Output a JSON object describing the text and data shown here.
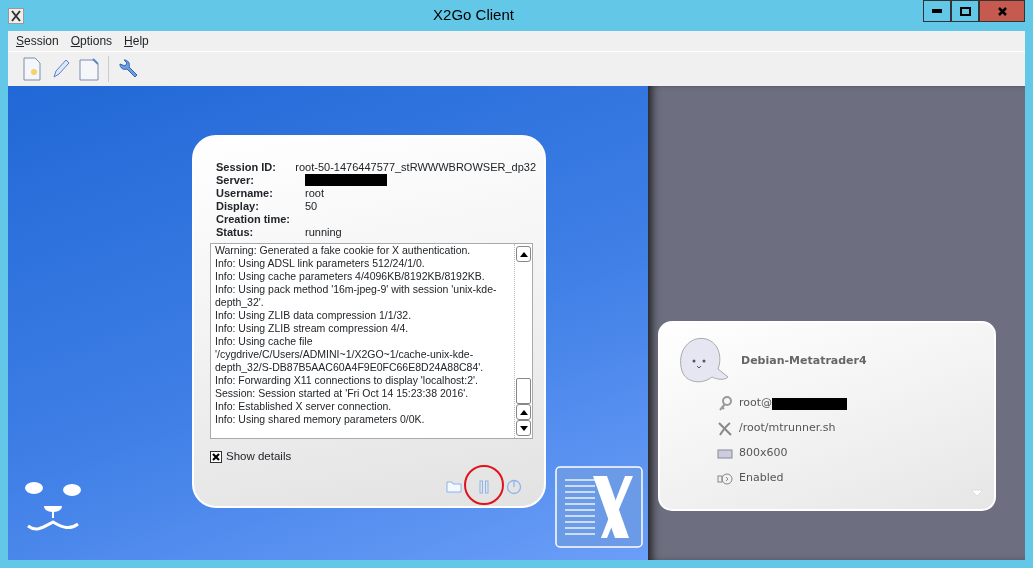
{
  "window": {
    "title": "X2Go Client"
  },
  "menu": [
    {
      "label": "Session"
    },
    {
      "label": "Options"
    },
    {
      "label": "Help"
    }
  ],
  "session_info": {
    "fields": [
      {
        "label": "Session ID:",
        "value": "root-50-1476447577_stRWWWBROWSER_dp32",
        "redacted": false
      },
      {
        "label": "Server:",
        "redacted": true
      },
      {
        "label": "Username:",
        "value": "root",
        "redacted": false
      },
      {
        "label": "Display:",
        "value": "50",
        "redacted": false
      },
      {
        "label": "Creation time:",
        "redacted": false
      },
      {
        "label": "Status:",
        "value": "running",
        "redacted": false
      }
    ],
    "log": [
      "Warning: Generated a fake cookie for X authentication.",
      "Info: Using ADSL link parameters 512/24/1/0.",
      "Info: Using cache parameters 4/4096KB/8192KB/8192KB.",
      "Info: Using pack method '16m-jpeg-9' with session 'unix-kde-",
      "depth_32'.",
      "Info: Using ZLIB data compression 1/1/32.",
      "Info: Using ZLIB stream compression 4/4.",
      "Info: Using cache file",
      "'/cygdrive/C/Users/ADMINI~1/X2GO~1/cache-unix-kde-",
      "depth_32/S-DB87B5AAC60A4F9E0FC66E8D24A88C84'.",
      "Info: Forwarding X11 connections to display 'localhost:2'.",
      "Session: Session started at 'Fri Oct 14 15:23:38 2016'.",
      "Info: Established X server connection.",
      "Info: Using shared memory parameters 0/0K."
    ],
    "show_details": {
      "label": "Show details",
      "checked": true
    }
  },
  "profile": {
    "name": "Debian-Metatrader4",
    "rows": [
      {
        "kind": "login",
        "text": "root@",
        "redacted": true
      },
      {
        "kind": "command",
        "text": "/root/mtrunner.sh",
        "redacted": false
      },
      {
        "kind": "display",
        "text": "800x600",
        "redacted": false
      },
      {
        "kind": "sound",
        "text": "Enabled",
        "redacted": false
      }
    ]
  }
}
